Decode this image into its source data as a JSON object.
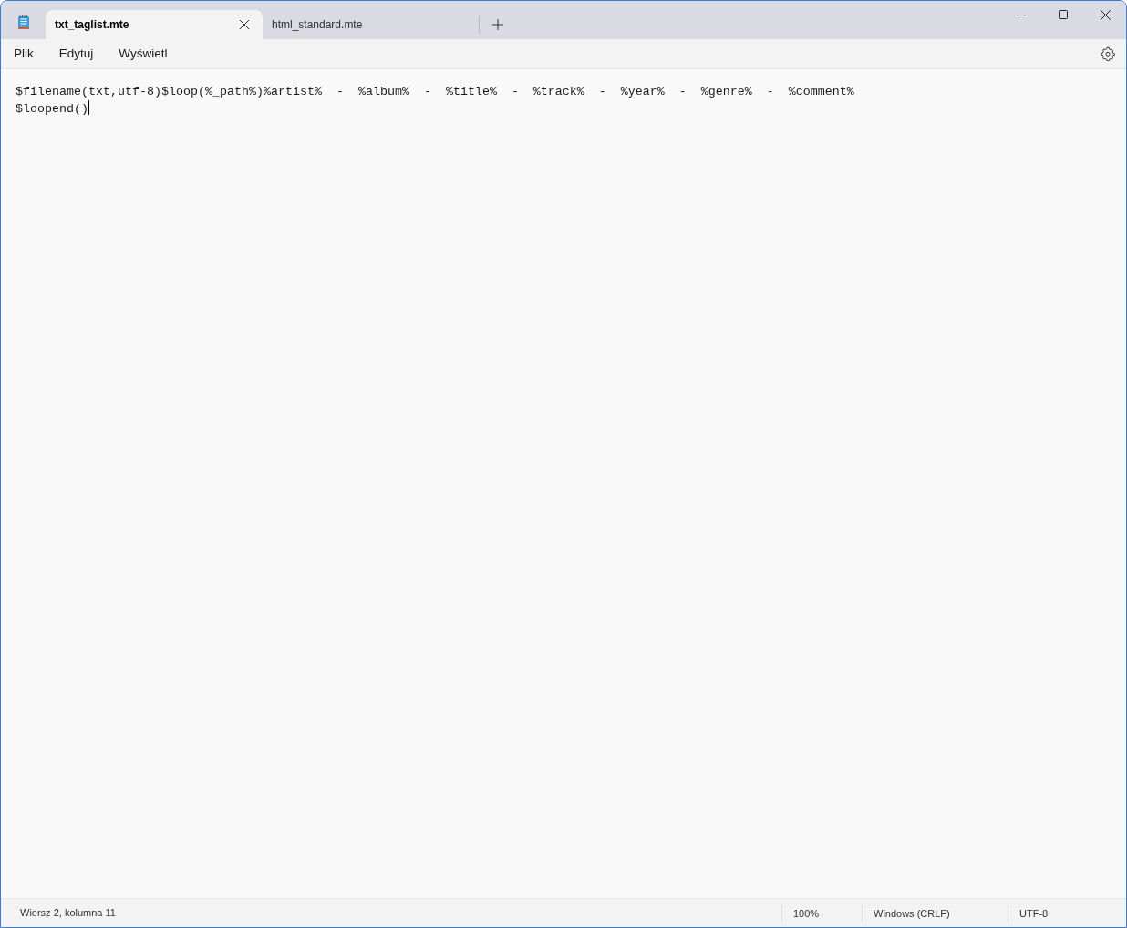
{
  "tabs": [
    {
      "label": "txt_taglist.mte",
      "selected": true
    },
    {
      "label": "html_standard.mte",
      "selected": false
    }
  ],
  "menu": [
    "Plik",
    "Edytuj",
    "Wyświetl"
  ],
  "editor": {
    "lines": [
      "$filename(txt,utf-8)$loop(%_path%)%artist%  -  %album%  -  %title%  -  %track%  -  %year%  -  %genre%  -  %comment%",
      "$loopend()"
    ]
  },
  "status_bar": {
    "position": "Wiersz 2, kolumna 11",
    "zoom": "100%",
    "line_ending": "Windows (CRLF)",
    "encoding": "UTF-8"
  }
}
